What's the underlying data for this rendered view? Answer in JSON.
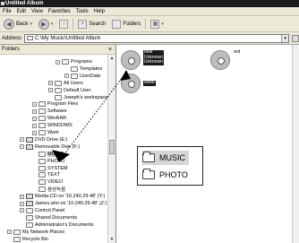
{
  "window": {
    "title": "Untitled Album"
  },
  "menu": [
    "File",
    "Edit",
    "View",
    "Favorites",
    "Tools",
    "Help"
  ],
  "toolbar": {
    "back_label": "Back",
    "search_label": "Search",
    "folders_label": "Folders",
    "views_icon": "views-icon"
  },
  "address": {
    "label": "Address",
    "path": "C:\\My Music\\Untitled Album"
  },
  "folders_pane": {
    "header": "Folders",
    "tree": [
      {
        "label": "Programs",
        "expander": "+"
      },
      {
        "label": "Templates",
        "expander": ""
      },
      {
        "label": "UserData",
        "expander": "+"
      },
      {
        "label": "All Users",
        "expander": "+"
      },
      {
        "label": "Default User",
        "expander": "+"
      },
      {
        "label": "Joseph's workspace",
        "expander": ""
      },
      {
        "label": "Program Files",
        "expander": "+"
      },
      {
        "label": "Software",
        "expander": "+"
      },
      {
        "label": "WinRAR",
        "expander": "+"
      },
      {
        "label": "WINDOWS",
        "expander": "+"
      },
      {
        "label": "Work",
        "expander": "+"
      },
      {
        "label": "DVD Drive (E:)",
        "expander": "+"
      },
      {
        "label": "Removable Disk (F:)",
        "expander": "−"
      },
      {
        "label": "MUSIC",
        "expander": ""
      },
      {
        "label": "PHOTO",
        "expander": ""
      },
      {
        "label": "SYSTEM",
        "expander": ""
      },
      {
        "label": "TEXT",
        "expander": ""
      },
      {
        "label": "VIDEO",
        "expander": ""
      },
      {
        "label": "음성녹음",
        "expander": ""
      },
      {
        "label": "Media-CD on '10.240.29.48' (Y:)",
        "expander": "+"
      },
      {
        "label": "James.ahn on '10.240.29.48' (Z:)",
        "expander": "+"
      },
      {
        "label": "Control Panel",
        "expander": "+"
      },
      {
        "label": "Shared Documents",
        "expander": ""
      },
      {
        "label": "Administrator's Documents",
        "expander": ""
      },
      {
        "label": "My Network Places",
        "expander": "+"
      },
      {
        "label": "Recycle Bin",
        "expander": ""
      }
    ]
  },
  "content": {
    "files": [
      {
        "lines": [
          "blue",
          "Unknown",
          "Unknown"
        ],
        "selected": true
      },
      {
        "lines": [
          "red"
        ],
        "selected": false
      },
      {
        "lines": [
          "white"
        ],
        "selected": true
      }
    ]
  },
  "callout": {
    "items": [
      "MUSIC",
      "PHOTO"
    ]
  }
}
